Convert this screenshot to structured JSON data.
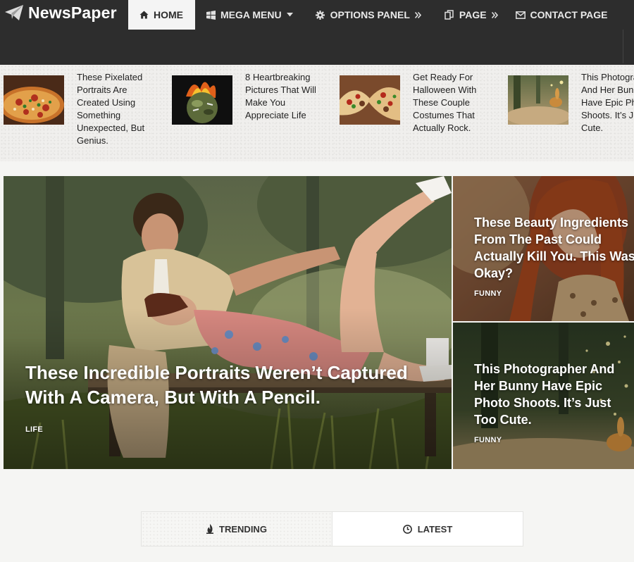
{
  "site": {
    "logo_text": "NewsPaper"
  },
  "nav": {
    "items": [
      {
        "label": "HOME",
        "icon": "home-icon",
        "active": true
      },
      {
        "label": "MEGA MENU",
        "icon": "windows-icon",
        "suffix": "caret-down-icon"
      },
      {
        "label": "OPTIONS PANEL",
        "icon": "gear-icon",
        "suffix": "double-chevron-right-icon"
      },
      {
        "label": "PAGE",
        "icon": "copy-icon",
        "suffix": "double-chevron-right-icon"
      },
      {
        "label": "CONTACT PAGE",
        "icon": "envelope-icon"
      }
    ]
  },
  "ticker": {
    "items": [
      {
        "title": "These Pixelated Portraits Are Created Using Something Unexpected, But Genius.",
        "thumb": "pizza-image"
      },
      {
        "title": "8 Heartbreaking Pictures That Will Make You Appreciate Life",
        "thumb": "burning-planet-image"
      },
      {
        "title": "Get Ready For Halloween With These Couple Costumes That Actually Rock.",
        "thumb": "tacos-image"
      },
      {
        "title": "This Photographer And Her Bunny Have Epic Photo Shoots. It’s Just Too Cute.",
        "thumb": "bunny-image"
      }
    ]
  },
  "hero": {
    "main": {
      "title": "These Incredible Portraits Weren’t Captured With A Camera, But With A Pencil.",
      "category": "LIFE"
    },
    "side": [
      {
        "title": "These Beauty Ingredients From The Past Could Actually Kill You. This Was Okay?",
        "category": "FUNNY"
      },
      {
        "title": "This Photographer And Her Bunny Have Epic Photo Shoots. It’s Just Too Cute.",
        "category": "FUNNY"
      }
    ]
  },
  "tabs": [
    {
      "label": "TRENDING",
      "icon": "flame-icon",
      "active": true
    },
    {
      "label": "LATEST",
      "icon": "clock-icon",
      "active": false
    }
  ],
  "colors": {
    "header_bg": "#2d2d2d",
    "nav_active_bg": "#f4f4f4",
    "page_bg": "#f5f5f3"
  }
}
